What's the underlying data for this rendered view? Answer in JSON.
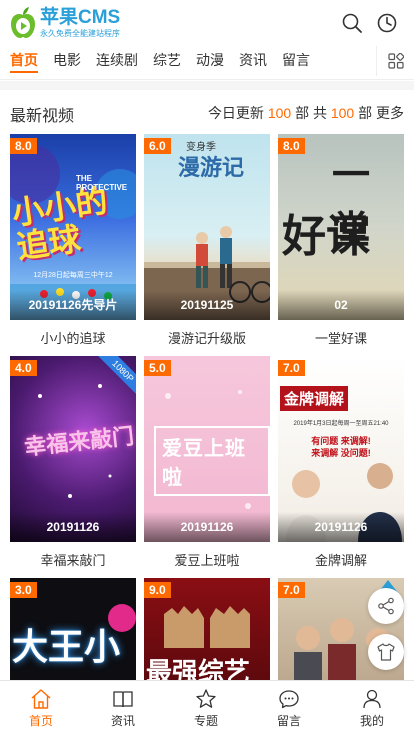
{
  "app": {
    "name": "苹果CMS",
    "slogan": "永久免费全能建站程序"
  },
  "header": {
    "search_icon": "search-icon",
    "history_icon": "clock-icon"
  },
  "nav": {
    "items": [
      "首页",
      "电影",
      "连续剧",
      "综艺",
      "动漫",
      "资讯",
      "留言"
    ],
    "active": "首页",
    "grid_icon": "grid-icon"
  },
  "section": {
    "title": "最新视频",
    "today_label": "今日更新",
    "today_count": "100",
    "unit1": "部",
    "total_label": "共",
    "total_count": "100",
    "unit2": "部",
    "more": "更多"
  },
  "videos": [
    {
      "title": "小小的追球",
      "score": "8.0",
      "note": "20191126先导片"
    },
    {
      "title": "漫游记升级版",
      "score": "6.0",
      "note": "20191125"
    },
    {
      "title": "一堂好课",
      "score": "8.0",
      "note": "02"
    },
    {
      "title": "幸福来敲门",
      "score": "4.0",
      "note": "20191126",
      "ribbon": "1080P"
    },
    {
      "title": "爱豆上班啦",
      "score": "5.0",
      "note": "20191126"
    },
    {
      "title": "金牌调解",
      "score": "7.0",
      "note": "20191126"
    },
    {
      "title": "",
      "score": "3.0",
      "note": ""
    },
    {
      "title": "",
      "score": "9.0",
      "note": ""
    },
    {
      "title": "",
      "score": "7.0",
      "note": ""
    }
  ],
  "posters": {
    "p1": {
      "big_text": "小小的追球",
      "eng": "THE PROTECTIVE",
      "small": "12月28日起每周三中午12"
    },
    "p2": {
      "top": "变身季",
      "big": "漫游记"
    },
    "p3": {
      "big": "好课",
      "small": "一堂"
    },
    "p4": {
      "big": "幸福来敲门"
    },
    "p5": {
      "big": "爱豆上班啦"
    },
    "p6": {
      "brand": "金牌调解",
      "sub": "有问题 来调解!",
      "sub2": "来调解 没问题!",
      "time": "2019年1月3日起每周一至周五21:40"
    },
    "p7": {
      "big": "大王小"
    },
    "p8": {
      "big": "最强综艺"
    }
  },
  "floats": {
    "top_icon": "back-to-top-icon",
    "share_icon": "share-icon",
    "skin_icon": "tshirt-icon"
  },
  "tabbar": {
    "items": [
      {
        "label": "首页",
        "icon": "home-icon"
      },
      {
        "label": "资讯",
        "icon": "book-icon"
      },
      {
        "label": "专题",
        "icon": "star-icon"
      },
      {
        "label": "留言",
        "icon": "chat-icon"
      },
      {
        "label": "我的",
        "icon": "user-icon"
      }
    ],
    "active": "首页"
  },
  "colors": {
    "accent": "#ff6a00",
    "brand": "#2a9fd8"
  }
}
